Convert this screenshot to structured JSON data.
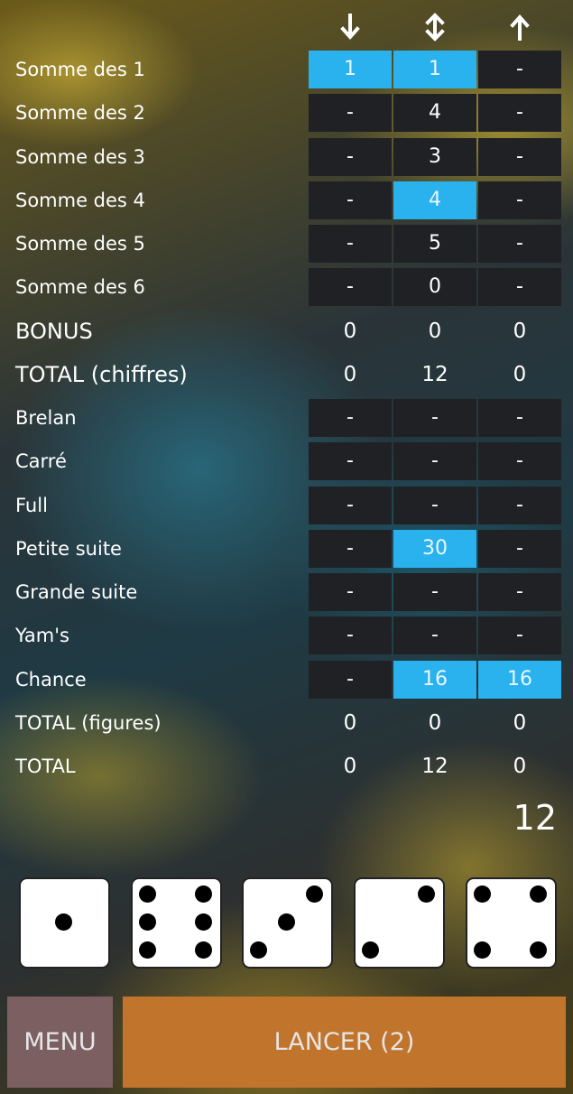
{
  "columns": [
    {
      "icon": "arrow-down-icon"
    },
    {
      "icon": "arrow-up-down-icon"
    },
    {
      "icon": "arrow-up-icon"
    }
  ],
  "rows": [
    {
      "label": "Somme des 1",
      "style": "normal",
      "kind": "slot",
      "values": [
        "1",
        "1",
        "-"
      ],
      "highlight": [
        true,
        true,
        false
      ]
    },
    {
      "label": "Somme des 2",
      "style": "normal",
      "kind": "slot",
      "values": [
        "-",
        "4",
        "-"
      ],
      "highlight": [
        false,
        false,
        false
      ]
    },
    {
      "label": "Somme des 3",
      "style": "normal",
      "kind": "slot",
      "values": [
        "-",
        "3",
        "-"
      ],
      "highlight": [
        false,
        false,
        false
      ]
    },
    {
      "label": "Somme des 4",
      "style": "normal",
      "kind": "slot",
      "values": [
        "-",
        "4",
        "-"
      ],
      "highlight": [
        false,
        true,
        false
      ]
    },
    {
      "label": "Somme des 5",
      "style": "normal",
      "kind": "slot",
      "values": [
        "-",
        "5",
        "-"
      ],
      "highlight": [
        false,
        false,
        false
      ]
    },
    {
      "label": "Somme des 6",
      "style": "normal",
      "kind": "slot",
      "values": [
        "-",
        "0",
        "-"
      ],
      "highlight": [
        false,
        false,
        false
      ]
    },
    {
      "label": "BONUS",
      "style": "big",
      "kind": "sum",
      "values": [
        "0",
        "0",
        "0"
      ],
      "highlight": [
        false,
        false,
        false
      ]
    },
    {
      "label": "TOTAL (chiffres)",
      "style": "big",
      "kind": "sum",
      "values": [
        "0",
        "12",
        "0"
      ],
      "highlight": [
        false,
        false,
        false
      ]
    },
    {
      "label": "Brelan",
      "style": "normal",
      "kind": "slot",
      "values": [
        "-",
        "-",
        "-"
      ],
      "highlight": [
        false,
        false,
        false
      ]
    },
    {
      "label": "Carré",
      "style": "normal",
      "kind": "slot",
      "values": [
        "-",
        "-",
        "-"
      ],
      "highlight": [
        false,
        false,
        false
      ]
    },
    {
      "label": "Full",
      "style": "normal",
      "kind": "slot",
      "values": [
        "-",
        "-",
        "-"
      ],
      "highlight": [
        false,
        false,
        false
      ]
    },
    {
      "label": "Petite suite",
      "style": "normal",
      "kind": "slot",
      "values": [
        "-",
        "30",
        "-"
      ],
      "highlight": [
        false,
        true,
        false
      ]
    },
    {
      "label": "Grande suite",
      "style": "normal",
      "kind": "slot",
      "values": [
        "-",
        "-",
        "-"
      ],
      "highlight": [
        false,
        false,
        false
      ]
    },
    {
      "label": "Yam's",
      "style": "normal",
      "kind": "slot",
      "values": [
        "-",
        "-",
        "-"
      ],
      "highlight": [
        false,
        false,
        false
      ]
    },
    {
      "label": "Chance",
      "style": "normal",
      "kind": "slot",
      "values": [
        "-",
        "16",
        "16"
      ],
      "highlight": [
        false,
        true,
        true
      ]
    },
    {
      "label": "TOTAL (figures)",
      "style": "normal",
      "kind": "sum",
      "values": [
        "0",
        "0",
        "0"
      ],
      "highlight": [
        false,
        false,
        false
      ]
    },
    {
      "label": "TOTAL",
      "style": "normal",
      "kind": "sum",
      "values": [
        "0",
        "12",
        "0"
      ],
      "highlight": [
        false,
        false,
        false
      ]
    }
  ],
  "grand_total": "12",
  "dice": [
    1,
    6,
    3,
    2,
    4
  ],
  "buttons": {
    "menu": "MENU",
    "roll": "LANCER (2)"
  },
  "colors": {
    "highlight": "#29b2ee",
    "slot": "#1f2124",
    "menu_button": "#7c5f60",
    "roll_button": "#c0742c"
  }
}
